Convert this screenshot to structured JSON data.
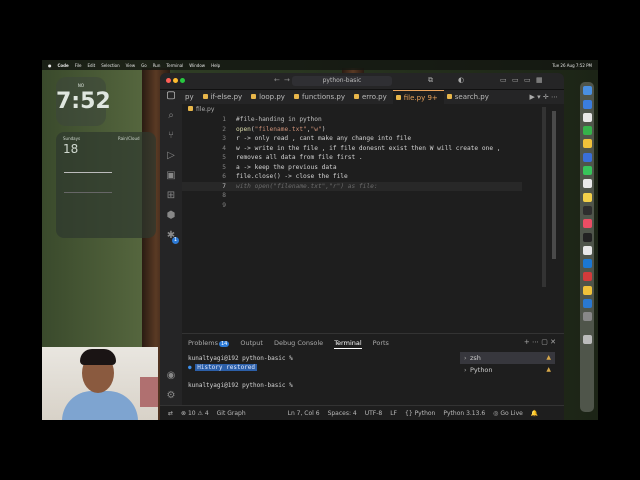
{
  "menubar": {
    "app": "Code",
    "items": [
      "File",
      "Edit",
      "Selection",
      "View",
      "Go",
      "Run",
      "Terminal",
      "Window",
      "Help"
    ],
    "clock": "Tue 26 Aug 7:52 PM"
  },
  "clock_widget": {
    "label": "NO",
    "time": "7:52"
  },
  "weather_widget": {
    "left": "Sundays",
    "right": "Rain/Cloud",
    "number": "18"
  },
  "window": {
    "search": "python-basic"
  },
  "tabs": [
    {
      "label": "py"
    },
    {
      "label": "if-else.py"
    },
    {
      "label": "loop.py"
    },
    {
      "label": "functions.py"
    },
    {
      "label": "erro.py"
    },
    {
      "label": "file.py 9+"
    },
    {
      "label": "search.py"
    }
  ],
  "breadcrumb": "file.py",
  "editor": {
    "lines": [
      {
        "n": "1",
        "parts": [
          {
            "t": "#file-handing in python",
            "c": "c-comment"
          }
        ]
      },
      {
        "n": "2",
        "parts": [
          {
            "t": "open",
            "c": "c-fn"
          },
          {
            "t": "(",
            "c": "c-txt"
          },
          {
            "t": "\"filename.txt\"",
            "c": "c-str"
          },
          {
            "t": ",",
            "c": "c-txt"
          },
          {
            "t": "\"w\"",
            "c": "c-str"
          },
          {
            "t": ")",
            "c": "c-txt"
          }
        ]
      },
      {
        "n": "3",
        "parts": [
          {
            "t": "r -> only read , cant make any change into file",
            "c": "c-txt"
          }
        ]
      },
      {
        "n": "4",
        "parts": [
          {
            "t": "w -> write in the file , if file donesnt exist then W will create one ,",
            "c": "c-txt"
          }
        ]
      },
      {
        "n": "5",
        "parts": [
          {
            "t": "removes all data from file first .",
            "c": "c-txt"
          }
        ]
      },
      {
        "n": "5",
        "parts": [
          {
            "t": "a -> keep the previous data",
            "c": "c-txt"
          }
        ]
      },
      {
        "n": "6",
        "parts": [
          {
            "t": "file.close() -> close the file",
            "c": "c-txt"
          }
        ]
      },
      {
        "n": "7",
        "parts": [
          {
            "t": "with open(\"filename.txt\",\"r\") as file:",
            "c": "ghost"
          }
        ],
        "current": true
      },
      {
        "n": "8",
        "parts": []
      },
      {
        "n": "9",
        "parts": []
      }
    ]
  },
  "panel": {
    "tabs": [
      "Problems",
      "Output",
      "Debug Console",
      "Terminal",
      "Ports"
    ],
    "problems_count": "14",
    "active": "Terminal",
    "terminal_lines": [
      "kunaltyagi@192 python-basic %",
      "History restored",
      "",
      "kunaltyagi@192 python-basic %"
    ],
    "terminal_list": [
      "zsh",
      "Python"
    ]
  },
  "status": {
    "errors": "10",
    "warnings": "4",
    "git": "Git Graph",
    "position": "Ln 7, Col 6",
    "spaces": "Spaces: 4",
    "encoding": "UTF-8",
    "eol": "LF",
    "language": "Python",
    "interpreter": "Python 3.13.6",
    "golive": "Go Live"
  }
}
